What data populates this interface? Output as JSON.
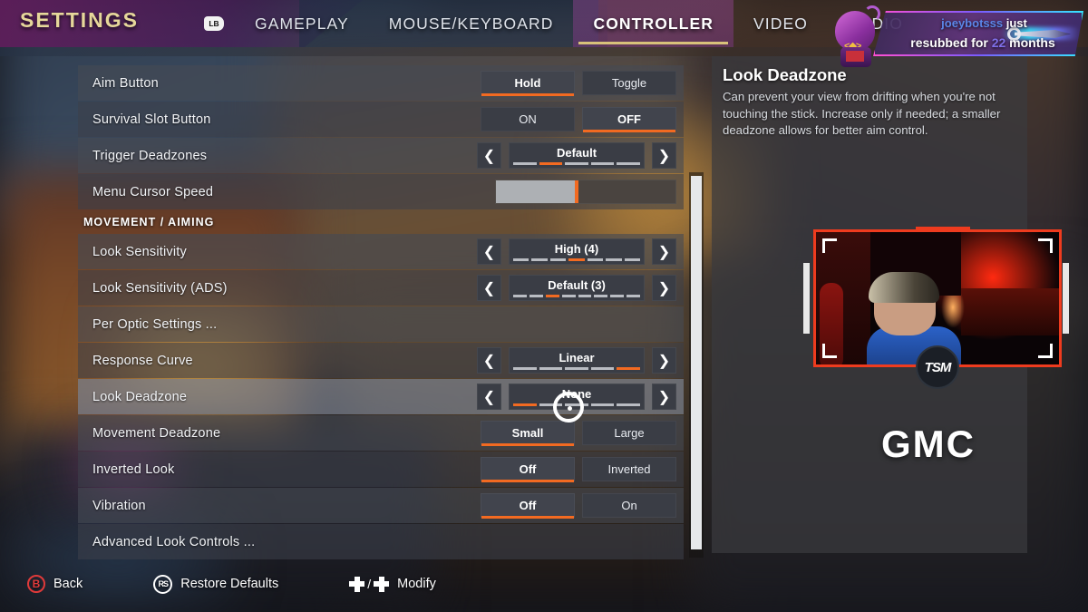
{
  "header": {
    "title": "SETTINGS",
    "bumper_icon_label": "LB",
    "tabs": [
      {
        "label": "GAMEPLAY",
        "active": false
      },
      {
        "label": "MOUSE/KEYBOARD",
        "active": false
      },
      {
        "label": "CONTROLLER",
        "active": true
      },
      {
        "label": "VIDEO",
        "active": false
      },
      {
        "label": "AUDIO",
        "active": false
      }
    ]
  },
  "settings": {
    "rows": [
      {
        "label": "Aim Button",
        "type": "toggle2",
        "options": [
          "Hold",
          "Toggle"
        ],
        "selected": 0
      },
      {
        "label": "Survival Slot Button",
        "type": "toggle2",
        "options": [
          "ON",
          "OFF"
        ],
        "selected": 1
      },
      {
        "label": "Trigger Deadzones",
        "type": "stepper",
        "value": "Default",
        "segments": 5,
        "active_segment": 2
      },
      {
        "label": "Menu Cursor Speed",
        "type": "slider",
        "fill_percent": 45
      }
    ],
    "section_header": "MOVEMENT / AIMING",
    "rows2": [
      {
        "label": "Look Sensitivity",
        "type": "stepper",
        "value": "High  (4)",
        "segments": 7,
        "active_segment": 4
      },
      {
        "label": "Look Sensitivity  (ADS)",
        "type": "stepper",
        "value": "Default (3)",
        "segments": 8,
        "active_segment": 3
      },
      {
        "label": "Per Optic Settings ...",
        "type": "link"
      },
      {
        "label": "Response Curve",
        "type": "stepper",
        "value": "Linear",
        "segments": 5,
        "active_segment": 5
      },
      {
        "label": "Look Deadzone",
        "type": "stepper",
        "value": "None",
        "segments": 5,
        "active_segment": 1,
        "highlighted": true
      },
      {
        "label": "Movement Deadzone",
        "type": "toggle2",
        "options": [
          "Small",
          "Large"
        ],
        "selected": 0
      },
      {
        "label": "Inverted Look",
        "type": "toggle2",
        "options": [
          "Off",
          "Inverted"
        ],
        "selected": 0
      },
      {
        "label": "Vibration",
        "type": "toggle2",
        "options": [
          "Off",
          "On"
        ],
        "selected": 0
      },
      {
        "label": "Advanced Look Controls ...",
        "type": "link"
      }
    ],
    "arrow_left": "❮",
    "arrow_right": "❯"
  },
  "info_panel": {
    "title": "Look Deadzone",
    "description": "Can prevent your view from drifting when you're not touching the stick. Increase only if needed; a smaller deadzone allows for better aim control."
  },
  "overlay": {
    "alert_line1_name": "joeybotsss",
    "alert_line1_rest": " just",
    "alert_line2_pre": "resubbed for ",
    "alert_line2_months": "22",
    "alert_line2_post": " months",
    "webcam_logo": "TSM",
    "sponsor_logo": "GMC"
  },
  "footer": {
    "items": [
      {
        "icon": "b-button-icon",
        "glyph": "B",
        "label": "Back"
      },
      {
        "icon": "right-stick-icon",
        "glyph": "RS",
        "label": "Restore Defaults"
      },
      {
        "icon": "dpad-icon",
        "glyph": "",
        "label": "Modify"
      }
    ],
    "dpad_separator": "/"
  },
  "colors": {
    "accent_orange": "#f26a21",
    "title_gold": "#e6d79a",
    "cam_border_red": "#ef3b1e"
  }
}
